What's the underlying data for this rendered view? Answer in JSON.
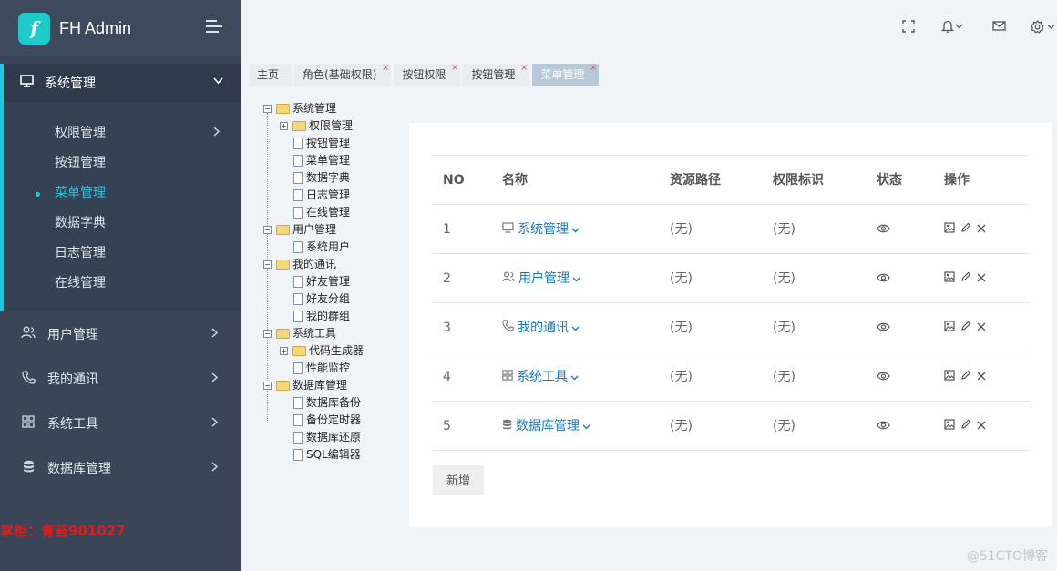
{
  "app": {
    "logo_letter": "f",
    "title": "FH Admin"
  },
  "sidebar": {
    "active_group": {
      "label": "系统管理",
      "icon": "monitor-icon"
    },
    "submenu": [
      {
        "label": "权限管理",
        "has_children": true
      },
      {
        "label": "按钮管理"
      },
      {
        "label": "菜单管理",
        "active": true
      },
      {
        "label": "数据字典"
      },
      {
        "label": "日志管理"
      },
      {
        "label": "在线管理"
      }
    ],
    "groups": [
      {
        "label": "用户管理",
        "icon": "users-icon"
      },
      {
        "label": "我的通讯",
        "icon": "phone-icon"
      },
      {
        "label": "系统工具",
        "icon": "grid-icon"
      },
      {
        "label": "数据库管理",
        "icon": "database-icon"
      }
    ],
    "overlay_text": "掌柜：青苔901027"
  },
  "tabs": [
    {
      "label": "主页",
      "closable": false
    },
    {
      "label": "角色(基础权限)",
      "closable": true
    },
    {
      "label": "按钮权限",
      "closable": true
    },
    {
      "label": "按钮管理",
      "closable": true
    },
    {
      "label": "菜单管理",
      "closable": true,
      "current": true
    }
  ],
  "tab_close_glyph": "×",
  "tree": [
    {
      "label": "系统管理",
      "type": "folder",
      "depth": 0,
      "expanded": true
    },
    {
      "label": "权限管理",
      "type": "folder",
      "depth": 1,
      "expanded": false
    },
    {
      "label": "按钮管理",
      "type": "file",
      "depth": 1
    },
    {
      "label": "菜单管理",
      "type": "file",
      "depth": 1
    },
    {
      "label": "数据字典",
      "type": "file",
      "depth": 1
    },
    {
      "label": "日志管理",
      "type": "file",
      "depth": 1
    },
    {
      "label": "在线管理",
      "type": "file",
      "depth": 1
    },
    {
      "label": "用户管理",
      "type": "folder",
      "depth": 0,
      "expanded": true
    },
    {
      "label": "系统用户",
      "type": "file",
      "depth": 1
    },
    {
      "label": "我的通讯",
      "type": "folder",
      "depth": 0,
      "expanded": true
    },
    {
      "label": "好友管理",
      "type": "file",
      "depth": 1
    },
    {
      "label": "好友分组",
      "type": "file",
      "depth": 1
    },
    {
      "label": "我的群组",
      "type": "file",
      "depth": 1
    },
    {
      "label": "系统工具",
      "type": "folder",
      "depth": 0,
      "expanded": true
    },
    {
      "label": "代码生成器",
      "type": "folder",
      "depth": 1,
      "expanded": false
    },
    {
      "label": "性能监控",
      "type": "file",
      "depth": 1
    },
    {
      "label": "数据库管理",
      "type": "folder",
      "depth": 0,
      "expanded": true
    },
    {
      "label": "数据库备份",
      "type": "file",
      "depth": 1
    },
    {
      "label": "备份定时器",
      "type": "file",
      "depth": 1
    },
    {
      "label": "数据库还原",
      "type": "file",
      "depth": 1
    },
    {
      "label": "SQL编辑器",
      "type": "file",
      "depth": 1
    }
  ],
  "table": {
    "headers": {
      "no": "NO",
      "name": "名称",
      "path": "资源路径",
      "perm": "权限标识",
      "status": "状态",
      "ops": "操作"
    },
    "rows": [
      {
        "no": "1",
        "name": "系统管理",
        "icon": "monitor-icon",
        "path": "(无)",
        "perm": "(无)"
      },
      {
        "no": "2",
        "name": "用户管理",
        "icon": "users-icon",
        "path": "(无)",
        "perm": "(无)"
      },
      {
        "no": "3",
        "name": "我的通讯",
        "icon": "phone-icon",
        "path": "(无)",
        "perm": "(无)"
      },
      {
        "no": "4",
        "name": "系统工具",
        "icon": "grid-icon",
        "path": "(无)",
        "perm": "(无)"
      },
      {
        "no": "5",
        "name": "数据库管理",
        "icon": "database-icon",
        "path": "(无)",
        "perm": "(无)"
      }
    ]
  },
  "buttons": {
    "add": "新增"
  },
  "footer_watermark": "@51CTO博客",
  "colors": {
    "sidebar_bg": "#3a4658",
    "accent": "#1ec9e0",
    "link": "#1a78c2",
    "tab_close": "#e05555"
  }
}
